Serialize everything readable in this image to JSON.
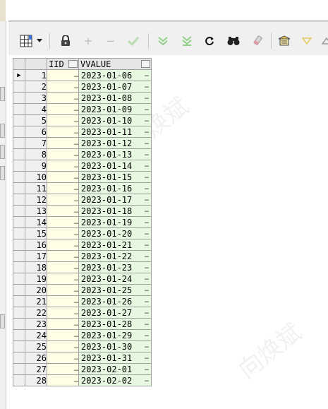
{
  "toolbar": {
    "icons": [
      "grid-view-icon",
      "dropdown-arrow-icon",
      "lock-icon",
      "add-record-icon",
      "delete-record-icon",
      "post-edit-icon",
      "fetch-next-page-icon",
      "fetch-last-page-icon",
      "refresh-icon",
      "find-icon",
      "clear-icon",
      "export-icon",
      "filter-icon",
      "sort-icon"
    ]
  },
  "grid": {
    "columns": [
      "IID",
      "VVALUE"
    ],
    "ellipsis": "…",
    "current_row_indicator": "▶",
    "rows": [
      {
        "num": "1",
        "vvalue": "2023-01-06"
      },
      {
        "num": "2",
        "vvalue": "2023-01-07"
      },
      {
        "num": "3",
        "vvalue": "2023-01-08"
      },
      {
        "num": "4",
        "vvalue": "2023-01-09"
      },
      {
        "num": "5",
        "vvalue": "2023-01-10"
      },
      {
        "num": "6",
        "vvalue": "2023-01-11"
      },
      {
        "num": "7",
        "vvalue": "2023-01-12"
      },
      {
        "num": "8",
        "vvalue": "2023-01-13"
      },
      {
        "num": "9",
        "vvalue": "2023-01-14"
      },
      {
        "num": "10",
        "vvalue": "2023-01-15"
      },
      {
        "num": "11",
        "vvalue": "2023-01-16"
      },
      {
        "num": "12",
        "vvalue": "2023-01-17"
      },
      {
        "num": "13",
        "vvalue": "2023-01-18"
      },
      {
        "num": "14",
        "vvalue": "2023-01-19"
      },
      {
        "num": "15",
        "vvalue": "2023-01-20"
      },
      {
        "num": "16",
        "vvalue": "2023-01-21"
      },
      {
        "num": "17",
        "vvalue": "2023-01-22"
      },
      {
        "num": "18",
        "vvalue": "2023-01-23"
      },
      {
        "num": "19",
        "vvalue": "2023-01-24"
      },
      {
        "num": "20",
        "vvalue": "2023-01-25"
      },
      {
        "num": "21",
        "vvalue": "2023-01-26"
      },
      {
        "num": "22",
        "vvalue": "2023-01-27"
      },
      {
        "num": "23",
        "vvalue": "2023-01-28"
      },
      {
        "num": "24",
        "vvalue": "2023-01-29"
      },
      {
        "num": "25",
        "vvalue": "2023-01-30"
      },
      {
        "num": "26",
        "vvalue": "2023-01-31"
      },
      {
        "num": "27",
        "vvalue": "2023-02-01"
      },
      {
        "num": "28",
        "vvalue": "2023-02-02"
      }
    ]
  },
  "watermark": "向焕斌",
  "colors": {
    "iid_cell": "#fffee5",
    "vvalue_cell": "#e6f8df",
    "header": "#e6e6e6",
    "toolbar_bg": "#f0f0f0"
  }
}
